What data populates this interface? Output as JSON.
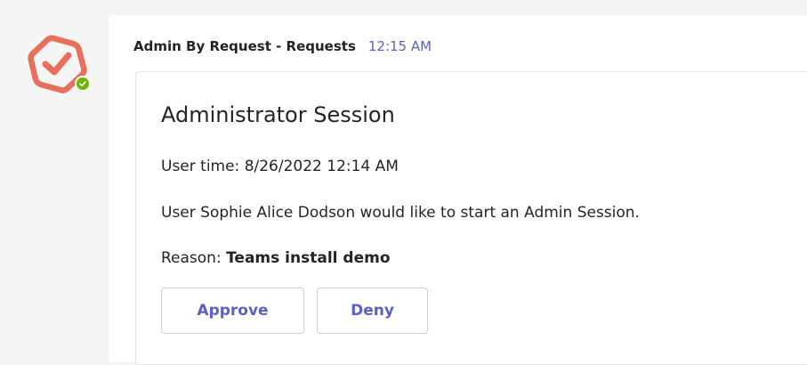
{
  "bot": {
    "avatar_icon": "admin-by-request-logo-icon",
    "brand_color": "#e8705a",
    "presence_icon": "available-check-icon",
    "presence_color": "#6bb700"
  },
  "message": {
    "sender": "Admin By Request - Requests",
    "time": "12:15 AM"
  },
  "card": {
    "title": "Administrator Session",
    "user_time": "User time: 8/26/2022 12:14 AM",
    "description": "User Sophie Alice Dodson would like to start an Admin Session.",
    "reason_label": "Reason: ",
    "reason_value": "Teams install demo",
    "actions": {
      "approve": "Approve",
      "deny": "Deny"
    }
  }
}
